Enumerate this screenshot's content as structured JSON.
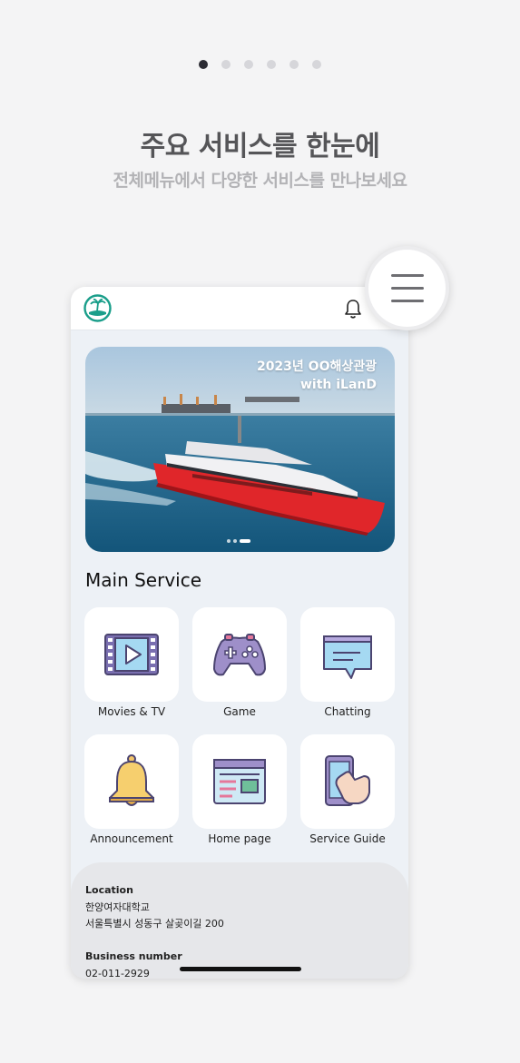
{
  "onboarding": {
    "page_count": 6,
    "active_page": 1,
    "title": "주요 서비스를 한눈에",
    "subtitle": "전체메뉴에서 다양한 서비스를 만나보세요"
  },
  "app": {
    "banner": {
      "line1": "2023년 OO해상관광",
      "line2": "with iLanD",
      "slide_count": 3,
      "active_slide": 3
    },
    "section_title": "Main Service",
    "services": [
      {
        "label": "Movies & TV",
        "icon": "movie-film-icon"
      },
      {
        "label": "Game",
        "icon": "gamepad-icon"
      },
      {
        "label": "Chatting",
        "icon": "chat-bubble-icon"
      },
      {
        "label": "Announcement",
        "icon": "bell-icon"
      },
      {
        "label": "Home page",
        "icon": "webpage-icon"
      },
      {
        "label": "Service Guide",
        "icon": "phone-tap-icon"
      }
    ],
    "footer": {
      "location_label": "Location",
      "location_line1": "한양여자대학교",
      "location_line2": "서울특별시 성동구 살곶이길 200",
      "business_label": "Business number",
      "business_number": "02-011-2929"
    }
  },
  "colors": {
    "accent": "#2c2c34",
    "logo_teal": "#1a9e8a",
    "ferry_red": "#e0262a",
    "sea_blue": "#1f6a8e"
  }
}
